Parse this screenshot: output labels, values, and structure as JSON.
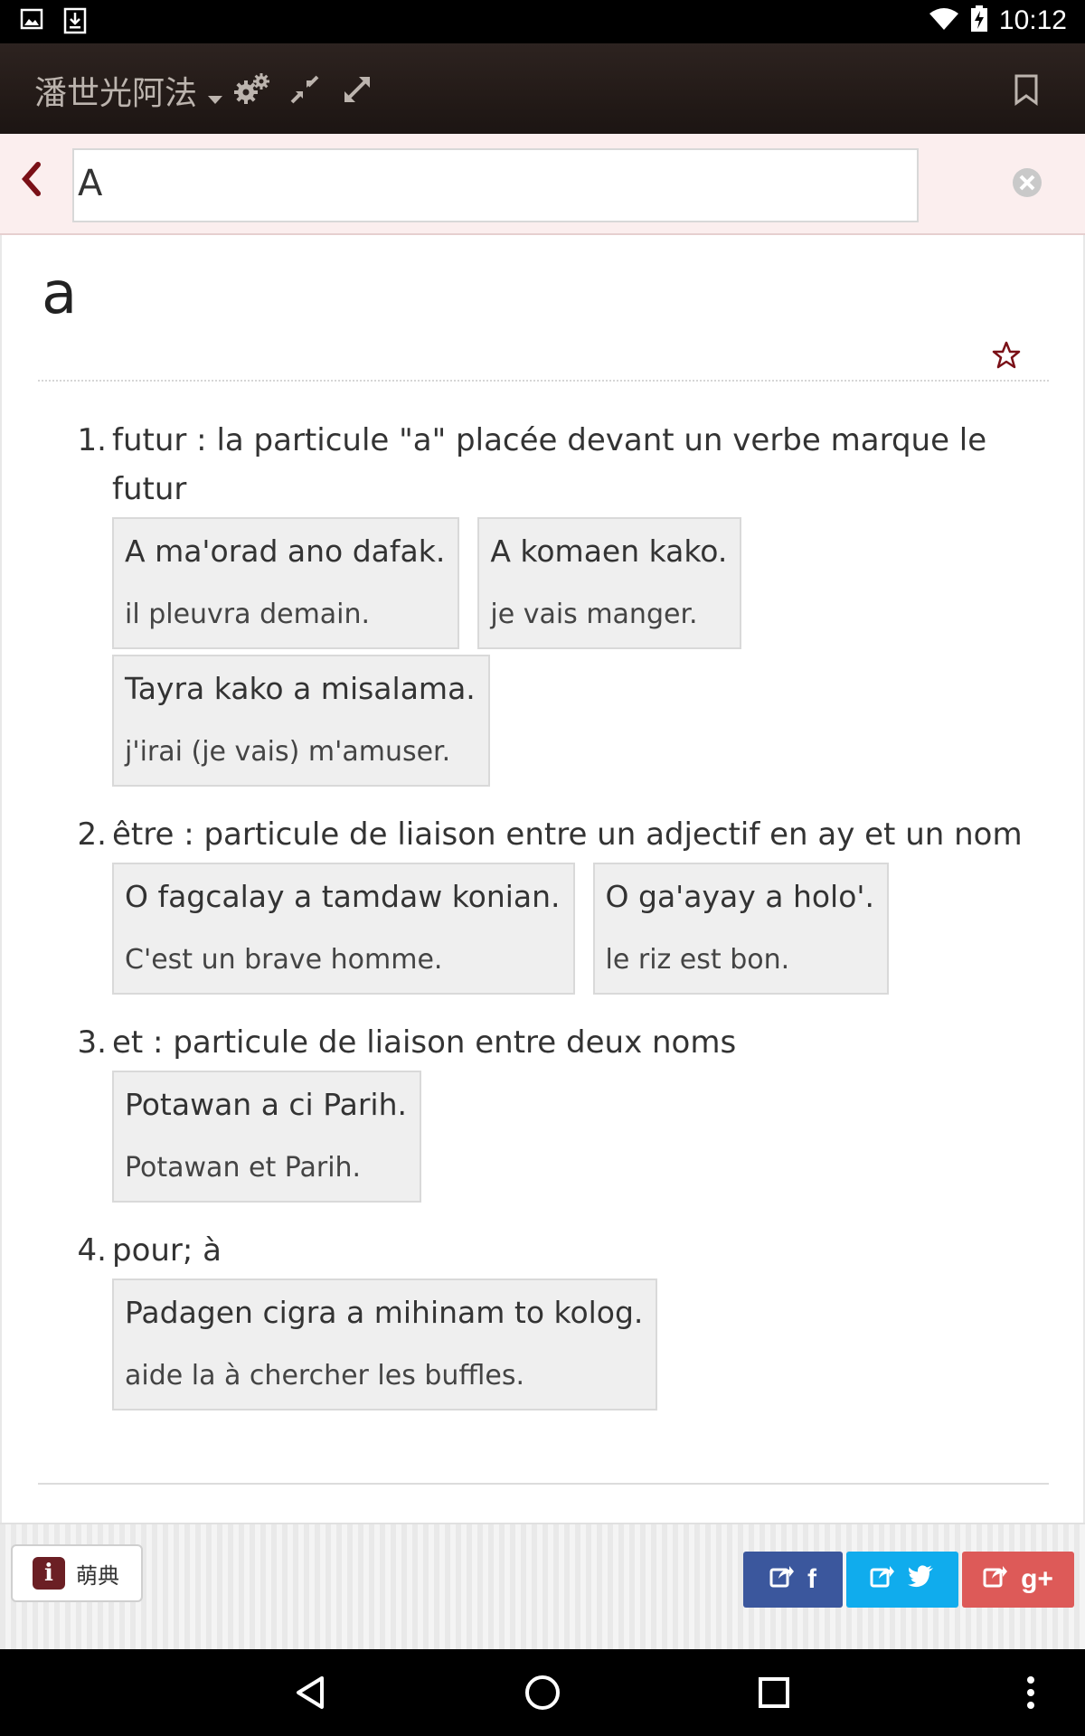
{
  "status_bar": {
    "time": "10:12"
  },
  "app_bar": {
    "title": "潘世光阿法"
  },
  "search": {
    "value": "A"
  },
  "entry": {
    "headword": "a",
    "senses": [
      {
        "number": "1.",
        "definition": "futur : la particule \"a\" placée devant un verbe marque le futur",
        "examples": [
          {
            "source": "A ma'orad ano dafak.",
            "translation": "il pleuvra demain."
          },
          {
            "source": "A komaen kako.",
            "translation": "je vais manger."
          },
          {
            "source": "Tayra kako a misalama.",
            "translation": "j'irai (je vais) m'amuser."
          }
        ]
      },
      {
        "number": "2.",
        "definition": "être : particule de liaison entre un adjectif en ay et un nom",
        "examples": [
          {
            "source": "O fagcalay a tamdaw konian.",
            "translation": "C'est un brave homme."
          },
          {
            "source": "O ga'ayay a holo'.",
            "translation": "le riz est bon."
          }
        ]
      },
      {
        "number": "3.",
        "definition": "et : particule de liaison entre deux noms",
        "examples": [
          {
            "source": "Potawan a ci Parih.",
            "translation": "Potawan et Parih."
          }
        ]
      },
      {
        "number": "4.",
        "definition": "pour; à",
        "examples": [
          {
            "source": "Padagen cigra a mihinam to kolog.",
            "translation": "aide la à chercher les buffles."
          }
        ]
      }
    ]
  },
  "footer": {
    "info_badge": "i",
    "info_label": "萌典",
    "share_facebook": "f",
    "share_google": "g+"
  },
  "colors": {
    "accent": "#7a1017",
    "facebook": "#3b579d",
    "twitter": "#10aced",
    "google": "#dd5a58"
  }
}
